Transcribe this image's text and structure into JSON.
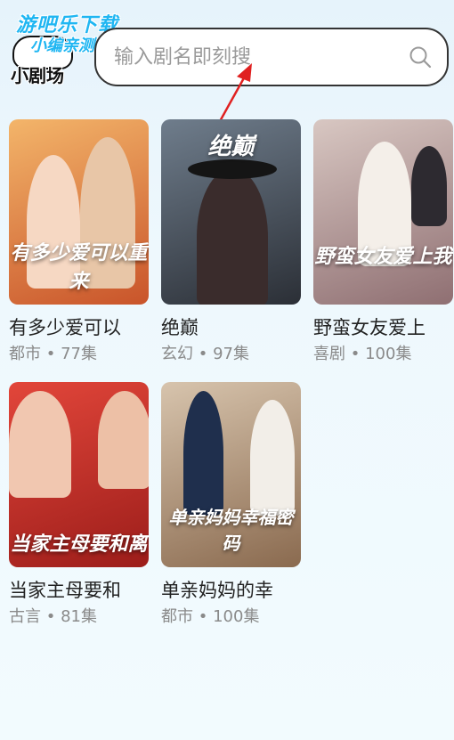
{
  "watermark": {
    "line1": "游吧乐下载",
    "line2": "小编亲测"
  },
  "app": {
    "name": "小剧场"
  },
  "search": {
    "placeholder": "输入剧名即刻搜"
  },
  "dramas": [
    {
      "title": "有多少爱可以",
      "genre": "都市",
      "episodes": "77集",
      "poster_text": "有多少爱可以重来",
      "colors": [
        "#f3b56a",
        "#c9542a"
      ]
    },
    {
      "title": "绝巅",
      "genre": "玄幻",
      "episodes": "97集",
      "poster_text": "绝巅",
      "colors": [
        "#6f7d8c",
        "#2b2f36"
      ]
    },
    {
      "title": "野蛮女友爱上",
      "genre": "喜剧",
      "episodes": "100集",
      "poster_text": "野蛮女友爱上我",
      "colors": [
        "#d8c7c2",
        "#8f6f72"
      ]
    },
    {
      "title": "当家主母要和",
      "genre": "古言",
      "episodes": "81集",
      "poster_text": "当家主母要和离",
      "colors": [
        "#e2463a",
        "#9c1d1a"
      ]
    },
    {
      "title": "单亲妈妈的幸",
      "genre": "都市",
      "episodes": "100集",
      "poster_text": "单亲妈妈幸福密码",
      "colors": [
        "#d7c4ad",
        "#8a6a4f"
      ]
    }
  ],
  "separator": "•"
}
